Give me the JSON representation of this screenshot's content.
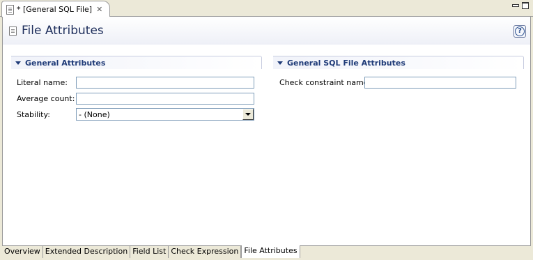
{
  "editor": {
    "tab_title": "* [General SQL File]",
    "close_icon": "close-icon",
    "file_icon": "document-icon"
  },
  "window_controls": {
    "minimize_icon": "minimize-icon",
    "maximize_icon": "maximize-icon"
  },
  "header": {
    "title": "File Attributes",
    "icon": "document-icon",
    "help_icon": "help-icon",
    "help_glyph": "?"
  },
  "general_section": {
    "title": "General Attributes",
    "fields": {
      "literal_name_label": "Literal name:",
      "literal_name_value": "",
      "average_count_label": "Average count:",
      "average_count_value": "",
      "stability_label": "Stability:",
      "stability_value": "- (None)"
    }
  },
  "sql_section": {
    "title": "General SQL File Attributes",
    "fields": {
      "check_constraint_label": "Check constraint name:",
      "check_constraint_value": ""
    }
  },
  "page_tabs": [
    {
      "label": "Overview",
      "active": false
    },
    {
      "label": "Extended Description",
      "active": false
    },
    {
      "label": "Field List",
      "active": false
    },
    {
      "label": "Check Expression",
      "active": false
    },
    {
      "label": "File Attributes",
      "active": true
    }
  ],
  "colors": {
    "title_color": "#1f2f5c",
    "section_title_color": "#1f3b78",
    "field_border": "#7f9db9",
    "chrome": "#ece9d8"
  }
}
